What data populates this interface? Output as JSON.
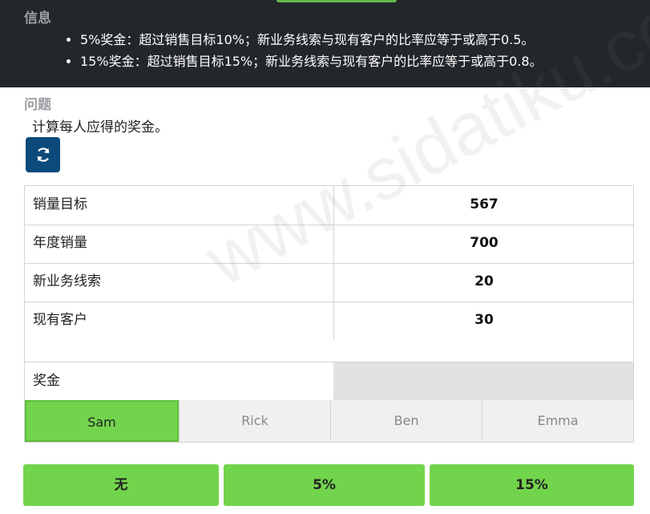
{
  "info": {
    "header": "信息",
    "bullets": [
      "5%奖金：超过销售目标10%；新业务线索与现有客户的比率应等于或高于0.5。",
      "15%奖金：超过销售目标15%；新业务线索与现有客户的比率应等于或高于0.8。"
    ]
  },
  "question": {
    "header": "问题",
    "text": "计算每人应得的奖金。"
  },
  "table": {
    "rows": [
      {
        "label": "销量目标",
        "value": "567"
      },
      {
        "label": "年度销量",
        "value": "700"
      },
      {
        "label": "新业务线索",
        "value": "20"
      },
      {
        "label": "现有客户",
        "value": "30"
      }
    ],
    "bonus_label": "奖金"
  },
  "tabs": [
    "Sam",
    "Rick",
    "Ben",
    "Emma"
  ],
  "active_tab": "Sam",
  "choices": [
    "无",
    "5%",
    "15%"
  ],
  "watermark": "www.sidatiku.com",
  "colors": {
    "accent": "#72d44c",
    "header_bg": "#23272b",
    "button_blue": "#0b4a7a"
  },
  "icons": {
    "reset": "refresh-icon"
  }
}
